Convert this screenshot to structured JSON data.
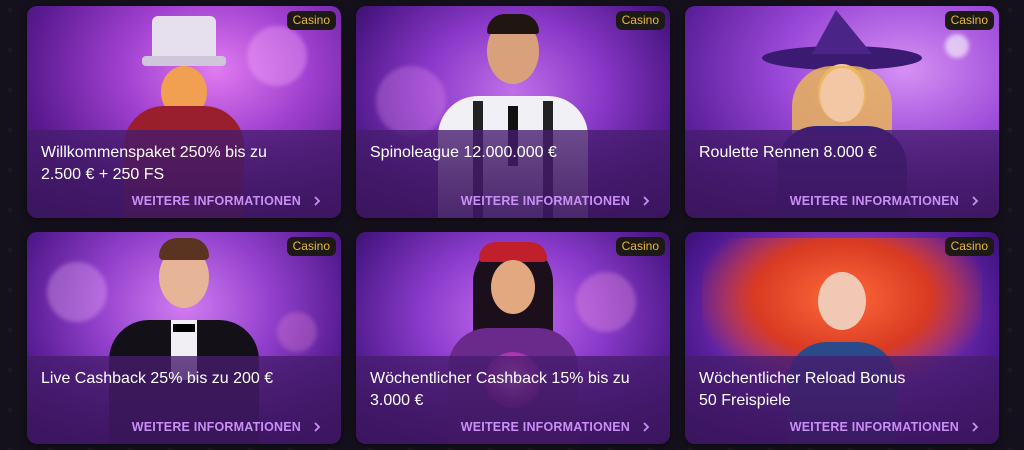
{
  "cards": [
    {
      "badge": "Casino",
      "title_lines": [
        "Willkommenspaket 250% bis zu",
        "2.500 € + 250 FS"
      ],
      "link": "WEITERE INFORMATIONEN",
      "character": "magician"
    },
    {
      "badge": "Casino",
      "title_lines": [
        "Spinoleague 12.000.000 €"
      ],
      "link": "WEITERE INFORMATIONEN",
      "character": "dealer-man"
    },
    {
      "badge": "Casino",
      "title_lines": [
        "Roulette Rennen 8.000 €"
      ],
      "link": "WEITERE INFORMATIONEN",
      "character": "witch"
    },
    {
      "badge": "Casino",
      "title_lines": [
        "Live Cashback 25% bis zu 200 €"
      ],
      "link": "WEITERE INFORMATIONEN",
      "character": "croupier"
    },
    {
      "badge": "Casino",
      "title_lines": [
        "Wöchentlicher Cashback 15% bis zu",
        "3.000 €"
      ],
      "link": "WEITERE INFORMATIONEN",
      "character": "fortune-teller"
    },
    {
      "badge": "Casino",
      "title_lines": [
        "Wöchentlicher Reload Bonus",
        "50 Freispiele"
      ],
      "link": "WEITERE INFORMATIONEN",
      "character": "red-haired-woman"
    }
  ],
  "colors": {
    "badge_text": "#e8b73c",
    "link_text": "#c98ff5",
    "background": "#15111c"
  }
}
